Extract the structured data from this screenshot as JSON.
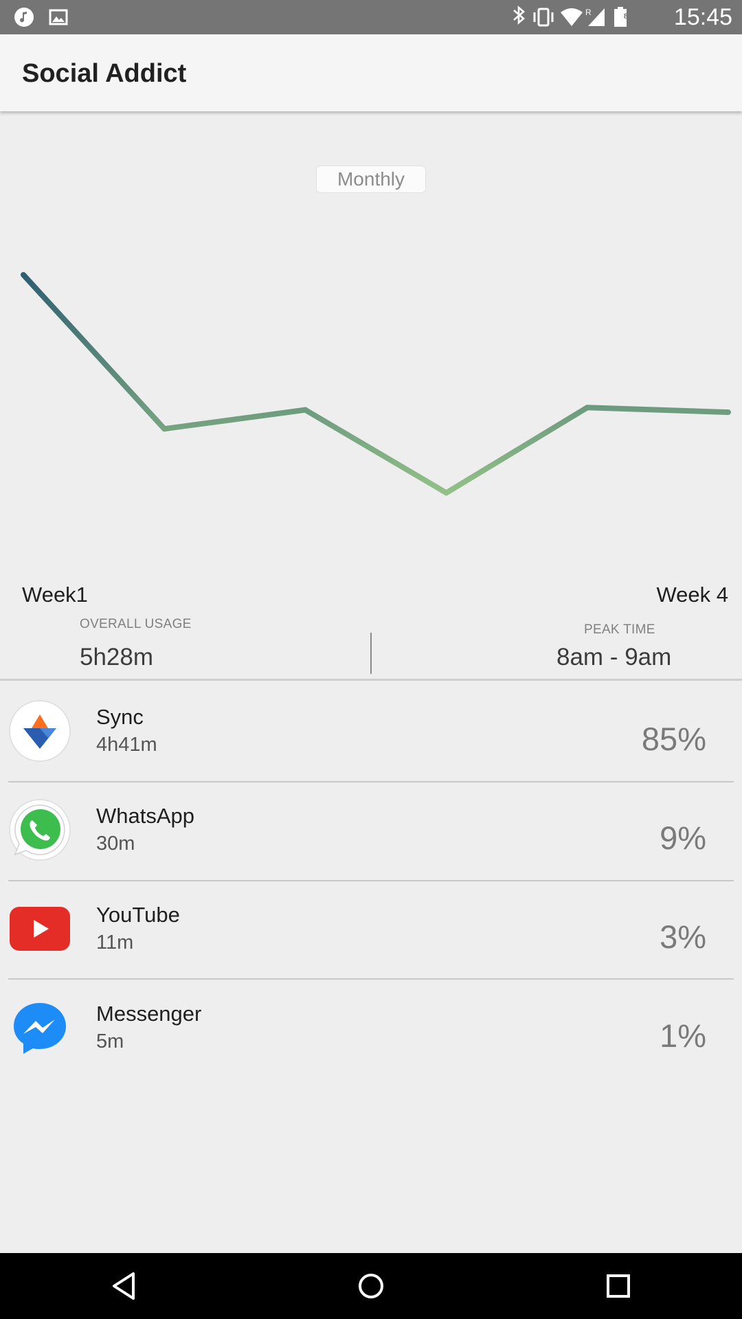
{
  "status_bar": {
    "time": "15:45",
    "battery_level": "81",
    "left_icons": [
      "music-note-icon",
      "image-icon"
    ],
    "right_icons": [
      "bluetooth-icon",
      "vibrate-icon",
      "wifi-icon",
      "signal-roaming-icon",
      "battery-icon"
    ]
  },
  "app_bar": {
    "title": "Social Addict"
  },
  "range_selector": {
    "label": "Monthly"
  },
  "chart_data": {
    "type": "line",
    "x": [
      "Week1",
      "",
      "",
      "",
      "",
      "Week 4"
    ],
    "values": [
      100,
      35,
      43,
      8,
      44,
      42
    ],
    "xlabel": "",
    "ylabel": "",
    "grid": false,
    "gradient_colors": [
      "#2f5f70",
      "#9cc98a"
    ]
  },
  "axis_labels": {
    "start": "Week1",
    "end": "Week 4"
  },
  "stats": {
    "overall_usage": {
      "caption": "OVERALL USAGE",
      "value": "5h28m"
    },
    "peak_time": {
      "caption": "PEAK TIME",
      "value": "8am - 9am"
    }
  },
  "apps": [
    {
      "name": "Sync",
      "time": "4h41m",
      "percent": "85%",
      "icon": "sync-icon"
    },
    {
      "name": "WhatsApp",
      "time": "30m",
      "percent": "9%",
      "icon": "whatsapp-icon"
    },
    {
      "name": "YouTube",
      "time": "11m",
      "percent": "3%",
      "icon": "youtube-icon"
    },
    {
      "name": "Messenger",
      "time": "5m",
      "percent": "1%",
      "icon": "messenger-icon"
    }
  ],
  "nav_bar": {
    "buttons": [
      "back-icon",
      "home-icon",
      "recents-icon"
    ]
  }
}
